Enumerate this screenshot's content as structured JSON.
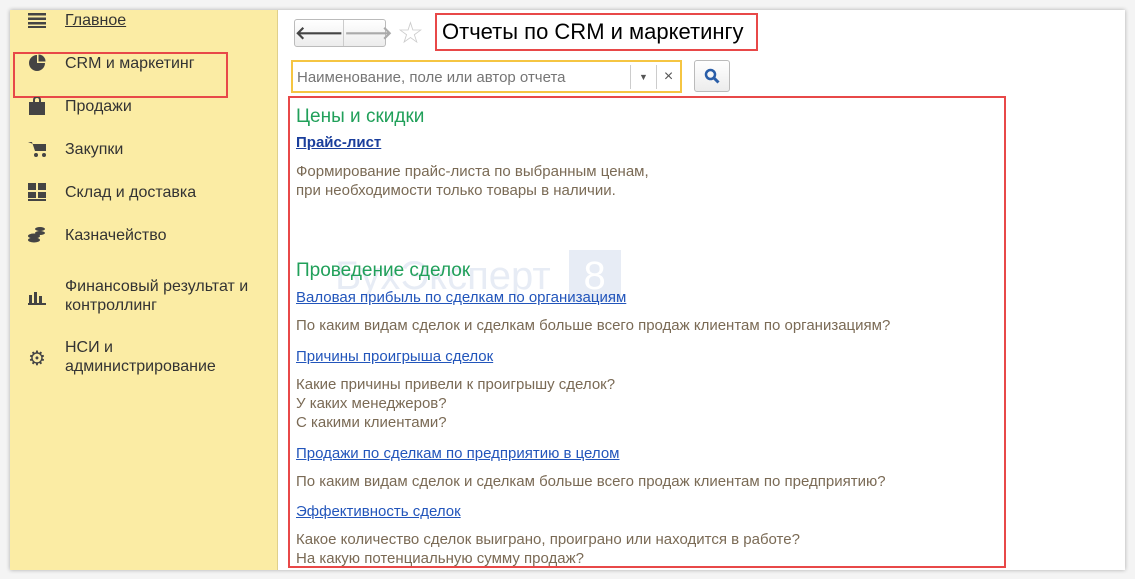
{
  "sidebar": {
    "items": [
      {
        "label": "Главное",
        "icon": "menu-icon"
      },
      {
        "label": "CRM и маркетинг",
        "icon": "pie-chart-icon"
      },
      {
        "label": "Продажи",
        "icon": "shopping-bag-icon"
      },
      {
        "label": "Закупки",
        "icon": "cart-icon"
      },
      {
        "label": "Склад и доставка",
        "icon": "warehouse-icon"
      },
      {
        "label": "Казначейство",
        "icon": "coins-icon"
      },
      {
        "label": "Финансовый результат и\nконтроллинг",
        "icon": "bar-chart-icon"
      },
      {
        "label": "НСИ и\nадминистрирование",
        "icon": "gear-icon"
      }
    ]
  },
  "header": {
    "title": "Отчеты по CRM и маркетингу",
    "back": "🡐",
    "forward": "🡒"
  },
  "search": {
    "placeholder": "Наименование, поле или автор отчета",
    "value": ""
  },
  "watermark": {
    "text": "БухЭксперт",
    "badge": "8"
  },
  "sections": [
    {
      "title": "Цены и скидки",
      "reports": [
        {
          "name": "Прайс-лист",
          "desc": "Формирование прайс-листа по выбранным ценам,\nпри необходимости только товары в наличии."
        }
      ]
    },
    {
      "title": "Проведение сделок",
      "reports": [
        {
          "name": "Валовая прибыль по сделкам по организациям",
          "desc": "По каким видам сделок и сделкам больше всего продаж клиентам по организациям?"
        },
        {
          "name": "Причины проигрыша сделок",
          "desc": "Какие причины привели к проигрышу сделок?\nУ каких менеджеров?\nС какими клиентами?"
        },
        {
          "name": "Продажи по сделкам по предприятию в целом",
          "desc": "По каким видам сделок и сделкам больше всего продаж клиентам по предприятию?"
        },
        {
          "name": "Эффективность сделок",
          "desc": "Какое количество сделок выиграно, проиграно или находится в работе?\nНа какую потенциальную сумму продаж?"
        }
      ]
    }
  ]
}
